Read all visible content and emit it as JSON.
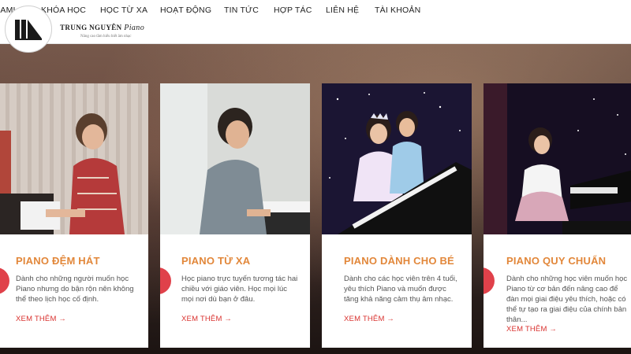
{
  "nav": {
    "items": [
      {
        "label": "GIỚI THIỆU TRUNG TÂM",
        "visible": "GIỚI THIỆU"
      },
      {
        "label": "KHÓA HỌC"
      },
      {
        "label": "HỌC TỪ XA"
      },
      {
        "label": "HOẠT ĐỘNG"
      },
      {
        "label": "TIN TỨC"
      },
      {
        "label": "HỢP TÁC"
      },
      {
        "label": "LIÊN HỆ"
      },
      {
        "label": "TÀI KHOẢN"
      }
    ]
  },
  "logo": {
    "name": "TRUNG NGUYÊN",
    "script": "Piano",
    "tagline": "Nâng cao tầm hiểu biết âm nhạc"
  },
  "cards": [
    {
      "title": "PIANO ĐỆM HÁT",
      "desc": "Dành cho những người muốn học Piano nhưng do bận rộn nên không thể theo lịch học cố định.",
      "more": "XEM THÊM →"
    },
    {
      "title": "PIANO TỪ XA",
      "desc": "Học piano trực tuyến tương tác hai chiều với giáo viên. Học mọi lúc mọi nơi dù bạn ở đâu.",
      "more": "XEM THÊM →"
    },
    {
      "title": "PIANO DÀNH CHO BÉ",
      "desc": "Dành cho các học viên trên 4 tuổi, yêu thích Piano và muốn được tăng khả năng cảm thụ âm nhạc.",
      "more": "XEM THÊM →"
    },
    {
      "title": "PIANO QUY CHUẨN",
      "desc": "Dành cho những học viên muốn học Piano từ cơ bản đến nâng cao để đàn mọi giai điệu yêu thích, hoặc có thể tự tạo ra giai điệu của chính bản thân...",
      "more": "XEM THÊM →"
    }
  ],
  "colors": {
    "accent_orange": "#e2873a",
    "accent_red": "#d9322f",
    "dot_red": "#e0414a"
  }
}
